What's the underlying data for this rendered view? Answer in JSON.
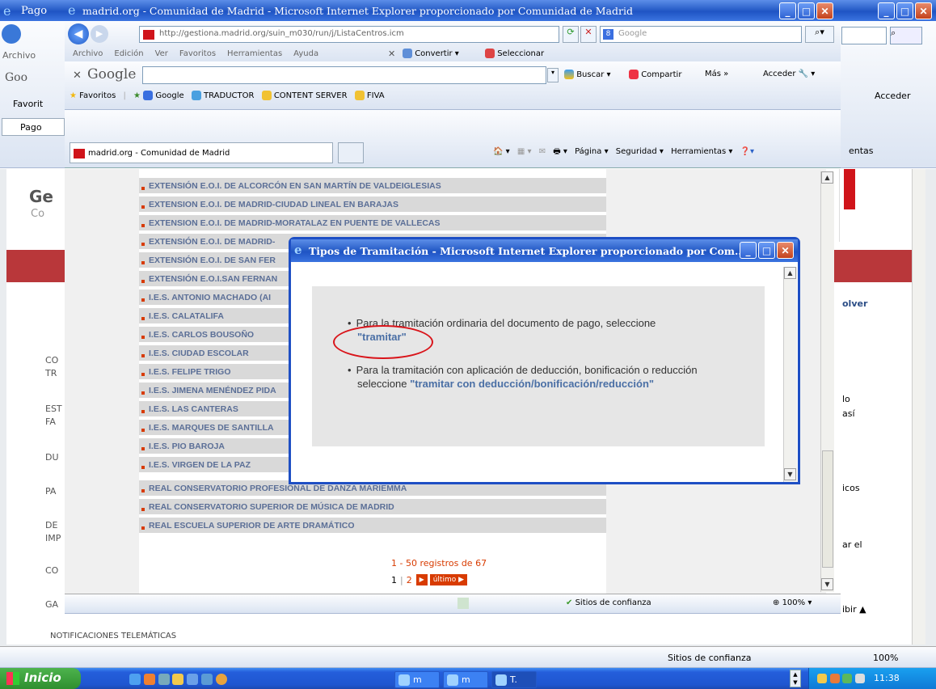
{
  "back_window": {
    "title_fragment": "Pago",
    "menu_archivo": "Archivo",
    "google_tab": "Goo",
    "favoritos": "Favorit",
    "tab": "Pago",
    "sidebar_items": [
      "CO",
      "TR",
      "EST",
      "FA",
      "DU",
      "PA",
      "DE",
      "IMP",
      "CO",
      "GA"
    ],
    "sidebar_bottom": "NOTIFICACIONES TELEMÁTICAS",
    "right_texts": {
      "volver": "olver",
      "lo": "lo",
      "asi": "así",
      "icos": "icos",
      "ar_el": "ar el",
      "ibir": "ibir ▲"
    },
    "header_letters": "Ge",
    "header_sub": "Co",
    "acceder": "Acceder",
    "herramientas": "entas",
    "zoom": "100%",
    "status_trust": "Sitios de confianza"
  },
  "main_window": {
    "title": "madrid.org - Comunidad de Madrid - Microsoft Internet Explorer proporcionado por Comunidad de Madrid",
    "url": "http://gestiona.madrid.org/suin_m030/run/j/ListaCentros.icm",
    "search_placeholder": "Google",
    "menu": [
      "Archivo",
      "Edición",
      "Ver",
      "Favoritos",
      "Herramientas",
      "Ayuda"
    ],
    "toolbar_convertir": "Convertir",
    "toolbar_seleccionar": "Seleccionar",
    "google_logo": "Google",
    "google_buscar": "Buscar",
    "google_compartir": "Compartir",
    "google_mas": "Más »",
    "google_acceder": "Acceder",
    "favoritos": "Favoritos",
    "fav_links": [
      "Google",
      "TRADUCTOR",
      "CONTENT SERVER",
      "FIVA"
    ],
    "tab_title": "madrid.org - Comunidad de Madrid",
    "cmd_pagina": "Página",
    "cmd_seguridad": "Seguridad",
    "cmd_herramientas": "Herramientas",
    "list_rows": [
      "EXTENSIÓN E.O.I. DE ALCORCÓN EN SAN MARTÍN DE VALDEIGLESIAS",
      "EXTENSION E.O.I. DE MADRID-CIUDAD LINEAL EN BARAJAS",
      "EXTENSION E.O.I. DE MADRID-MORATALAZ EN PUENTE DE VALLECAS",
      "EXTENSIÓN E.O.I. DE MADRID-",
      "EXTENSIÓN E.O.I. DE SAN FER",
      "EXTENSIÓN E.O.I.SAN FERNAN",
      "I.E.S. ANTONIO MACHADO (AI",
      "I.E.S. CALATALIFA",
      "I.E.S. CARLOS BOUSOÑO",
      "I.E.S. CIUDAD ESCOLAR",
      "I.E.S. FELIPE TRIGO",
      "I.E.S. JIMENA MENÉNDEZ PIDA",
      "I.E.S. LAS CANTERAS",
      "I.E.S. MARQUES DE SANTILLA",
      "I.E.S. PIO BAROJA",
      "I.E.S. VIRGEN DE LA PAZ",
      "REAL CONSERVATORIO PROFESIONAL DE DANZA MARIEMMA",
      "REAL CONSERVATORIO SUPERIOR DE MÚSICA DE MADRID",
      "REAL ESCUELA SUPERIOR DE ARTE DRAMÁTICO"
    ],
    "pagination_info": "1 - 50 registros de 67",
    "page_current": "1",
    "page_sep": "|",
    "page_2": "2",
    "page_last": "último",
    "status_trust": "Sitios de confianza",
    "zoom": "100%"
  },
  "dialog": {
    "title": "Tipos de Tramitación - Microsoft Internet Explorer proporcionado por Com...",
    "item1_text": "Para la tramitación ordinaria del documento de pago, seleccione",
    "item1_link": "\"tramitar\"",
    "item2_text_a": "Para la tramitación con aplicación de deducción, bonificación o reducción",
    "item2_text_b": "seleccione",
    "item2_link": "\"tramitar con deducción/bonificación/reducción\""
  },
  "taskbar": {
    "start": "Inicio",
    "tasks": [
      "m",
      "m",
      "T."
    ],
    "clock": "11:38"
  },
  "colors": {
    "xp_blue": "#245edb",
    "link_blue": "#4a6fa5",
    "row_text": "#5b6f97",
    "annotation_red": "#d9141a",
    "pager_orange": "#d83b01"
  }
}
